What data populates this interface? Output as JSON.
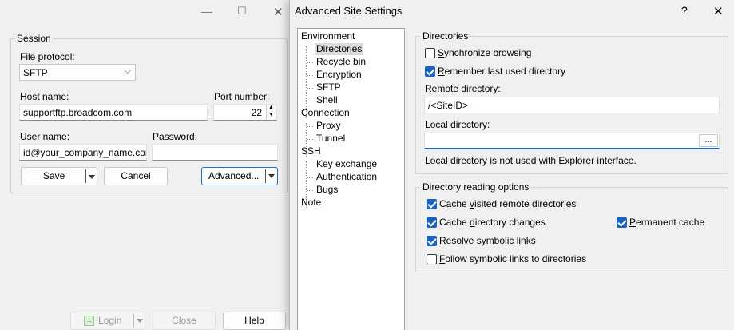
{
  "login": {
    "session_group": "Session",
    "file_protocol_label": "File protocol:",
    "file_protocol_value": "SFTP",
    "host_label": "Host name:",
    "host_value": "supportftp.broadcom.com",
    "port_label": "Port number:",
    "port_value": "22",
    "user_label": "User name:",
    "user_value": "id@your_company_name.com",
    "password_label": "Password:",
    "password_value": "",
    "save_label": "Save",
    "cancel_label": "Cancel",
    "advanced_label": "Advanced...",
    "login_label": "Login",
    "close_label": "Close",
    "help_label": "Help"
  },
  "dialog": {
    "title": "Advanced Site Settings",
    "help_glyph": "?",
    "close_glyph": "✕",
    "tree": [
      {
        "label": "Environment",
        "level": 0
      },
      {
        "label": "Directories",
        "level": 1,
        "selected": true
      },
      {
        "label": "Recycle bin",
        "level": 1
      },
      {
        "label": "Encryption",
        "level": 1
      },
      {
        "label": "SFTP",
        "level": 1
      },
      {
        "label": "Shell",
        "level": 1
      },
      {
        "label": "Connection",
        "level": 0
      },
      {
        "label": "Proxy",
        "level": 1
      },
      {
        "label": "Tunnel",
        "level": 1
      },
      {
        "label": "SSH",
        "level": 0
      },
      {
        "label": "Key exchange",
        "level": 1
      },
      {
        "label": "Authentication",
        "level": 1
      },
      {
        "label": "Bugs",
        "level": 1
      },
      {
        "label": "Note",
        "level": 0
      }
    ],
    "directories": {
      "group_title": "Directories",
      "sync_label": "Synchronize browsing",
      "sync_checked": false,
      "remember_label": "Remember last used directory",
      "remember_checked": true,
      "remote_label": "Remote directory:",
      "remote_value": "/<SiteID>",
      "local_label": "Local directory:",
      "local_value": "",
      "browse_label": "...",
      "local_note": "Local directory is not used with Explorer interface."
    },
    "reading": {
      "group_title": "Directory reading options",
      "cache_visited_label": "Cache visited remote directories",
      "cache_visited_checked": true,
      "cache_changes_label": "Cache directory changes",
      "cache_changes_checked": true,
      "permanent_label": "Permanent cache",
      "permanent_checked": true,
      "resolve_label": "Resolve symbolic links",
      "resolve_checked": true,
      "follow_label": "Follow symbolic links to directories",
      "follow_checked": false
    }
  }
}
